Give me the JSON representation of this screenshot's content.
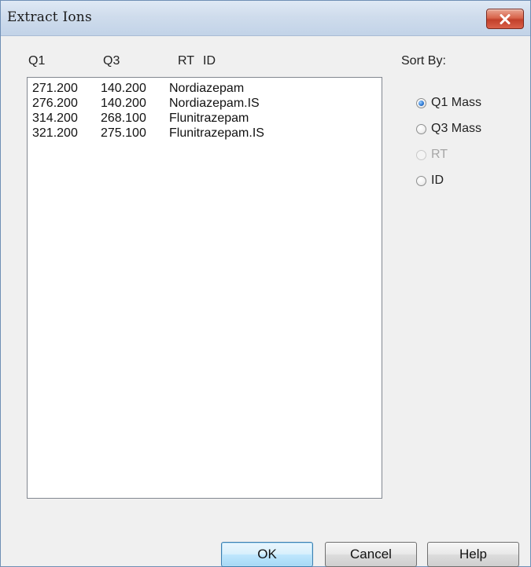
{
  "window": {
    "title": "Extract Ions"
  },
  "columns": {
    "q1": "Q1",
    "q3": "Q3",
    "rt": "RT",
    "id": "ID"
  },
  "ions": [
    {
      "q1": "271.200",
      "q3": "140.200",
      "id": "Nordiazepam"
    },
    {
      "q1": "276.200",
      "q3": "140.200",
      "id": "Nordiazepam.IS"
    },
    {
      "q1": "314.200",
      "q3": "268.100",
      "id": "Flunitrazepam"
    },
    {
      "q1": "321.200",
      "q3": "275.100",
      "id": "Flunitrazepam.IS"
    }
  ],
  "sort": {
    "label": "Sort By:",
    "options": [
      {
        "label": "Q1 Mass",
        "checked": true,
        "enabled": true
      },
      {
        "label": "Q3 Mass",
        "checked": false,
        "enabled": true
      },
      {
        "label": "RT",
        "checked": false,
        "enabled": false
      },
      {
        "label": "ID",
        "checked": false,
        "enabled": true
      }
    ]
  },
  "buttons": {
    "ok": "OK",
    "cancel": "Cancel",
    "help": "Help"
  },
  "colors": {
    "close_button": "#c94b34",
    "default_button_border": "#3c7fb1",
    "radio_selected": "#2f7bd6"
  },
  "icons": {
    "close": "close-icon"
  }
}
